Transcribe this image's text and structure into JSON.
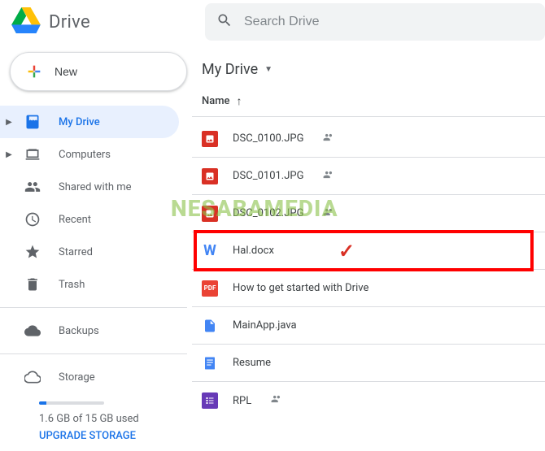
{
  "header": {
    "app_name": "Drive",
    "search_placeholder": "Search Drive"
  },
  "sidebar": {
    "new_label": "New",
    "items": [
      {
        "label": "My Drive",
        "icon": "drive"
      },
      {
        "label": "Computers",
        "icon": "computers"
      },
      {
        "label": "Shared with me",
        "icon": "shared"
      },
      {
        "label": "Recent",
        "icon": "recent"
      },
      {
        "label": "Starred",
        "icon": "star"
      },
      {
        "label": "Trash",
        "icon": "trash"
      }
    ],
    "backups_label": "Backups",
    "storage": {
      "title": "Storage",
      "used_text": "1.6 GB of 15 GB used",
      "upgrade_label": "UPGRADE STORAGE"
    }
  },
  "main": {
    "location": "My Drive",
    "column_header": "Name",
    "sort_indicator": "↑",
    "files": [
      {
        "name": "DSC_0100.JPG",
        "type": "img",
        "shared": true
      },
      {
        "name": "DSC_0101.JPG",
        "type": "img",
        "shared": true
      },
      {
        "name": "DSC_0102.JPG",
        "type": "img",
        "shared": true
      },
      {
        "name": "Hal.docx",
        "type": "word",
        "shared": false,
        "highlighted": true
      },
      {
        "name": "How to get started with Drive",
        "type": "pdf",
        "shared": false
      },
      {
        "name": "MainApp.java",
        "type": "file",
        "shared": false
      },
      {
        "name": "Resume",
        "type": "doc",
        "shared": false
      },
      {
        "name": "RPL",
        "type": "purple",
        "shared": true
      }
    ]
  },
  "watermark_text": "NESABAMEDIA"
}
